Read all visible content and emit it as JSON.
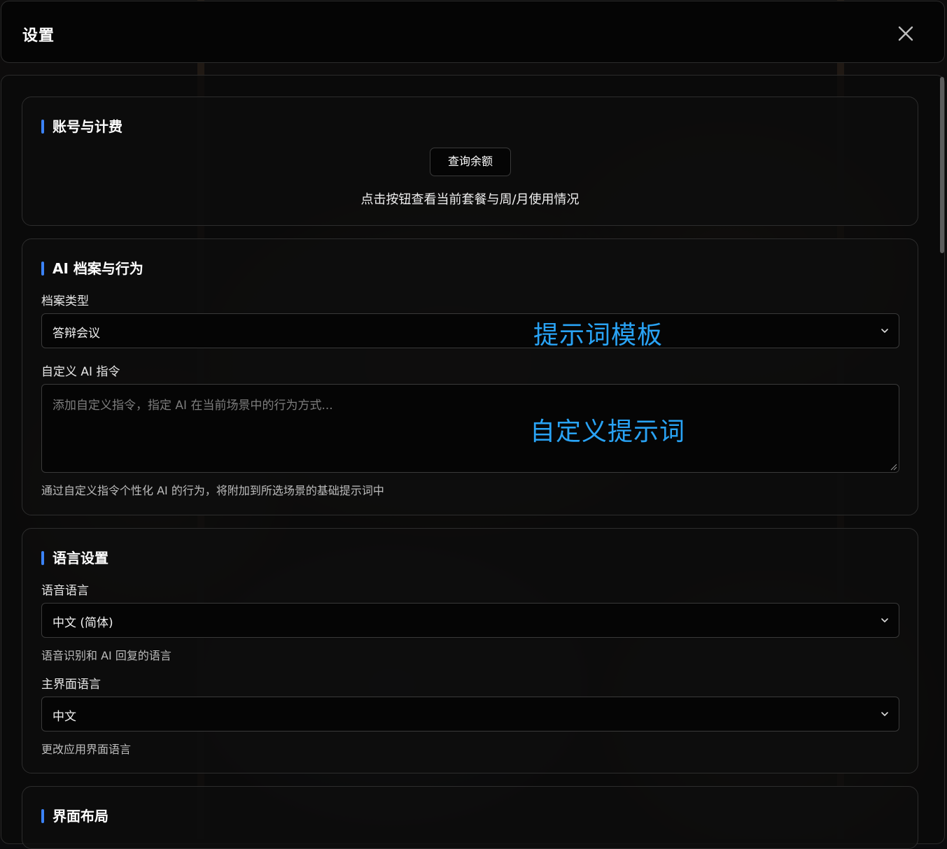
{
  "dialog": {
    "title": "设置",
    "close_icon": "close-icon"
  },
  "account": {
    "title": "账号与计费",
    "button_label": "查询余额",
    "description": "点击按钮查看当前套餐与周/月使用情况"
  },
  "ai_profile": {
    "title": "AI 档案与行为",
    "profile_type_label": "档案类型",
    "profile_type_value": "答辩会议",
    "custom_instr_label": "自定义 AI 指令",
    "custom_instr_placeholder": "添加自定义指令，指定 AI 在当前场景中的行为方式...",
    "custom_instr_hint": "通过自定义指令个性化 AI 的行为，将附加到所选场景的基础提示词中"
  },
  "annotations": {
    "template_note": "提示词模板",
    "custom_note": "自定义提示词"
  },
  "language": {
    "title": "语言设置",
    "speech_label": "语音语言",
    "speech_value": "中文 (简体)",
    "speech_hint": "语音识别和 AI 回复的语言",
    "ui_label": "主界面语言",
    "ui_value": "中文",
    "ui_hint": "更改应用界面语言"
  },
  "layout": {
    "title": "界面布局"
  },
  "colors": {
    "accent": "#3b82f6",
    "annotation": "#29a3f5",
    "background": "#0b0b0d"
  }
}
